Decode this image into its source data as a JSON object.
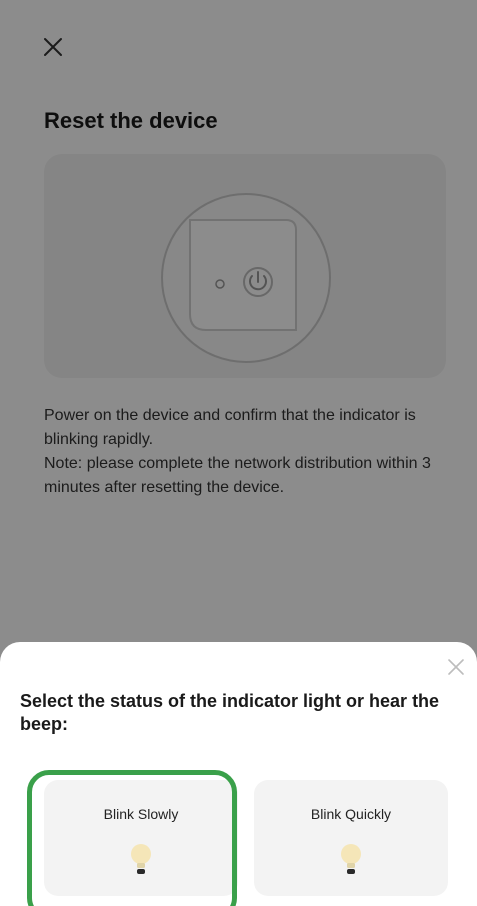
{
  "page": {
    "title": "Reset the device",
    "instructions": [
      "Power on the device and confirm that the indicator is blinking rapidly.",
      "Note: please complete the network distribution within 3 minutes after resetting the device."
    ]
  },
  "sheet": {
    "title": "Select the status of the indicator light or hear the beep:",
    "options": [
      {
        "label": "Blink Slowly",
        "selected": true
      },
      {
        "label": "Blink Quickly",
        "selected": false
      }
    ]
  },
  "icons": {
    "top_close": "close-icon",
    "sheet_close": "close-icon",
    "option_icon": "lightbulb-icon",
    "device_button": "power-icon"
  },
  "colors": {
    "selection_ring": "#3aa04a",
    "bulb_glow": "#f5e6b8",
    "overlay": "rgba(0,0,0,0.45)"
  }
}
